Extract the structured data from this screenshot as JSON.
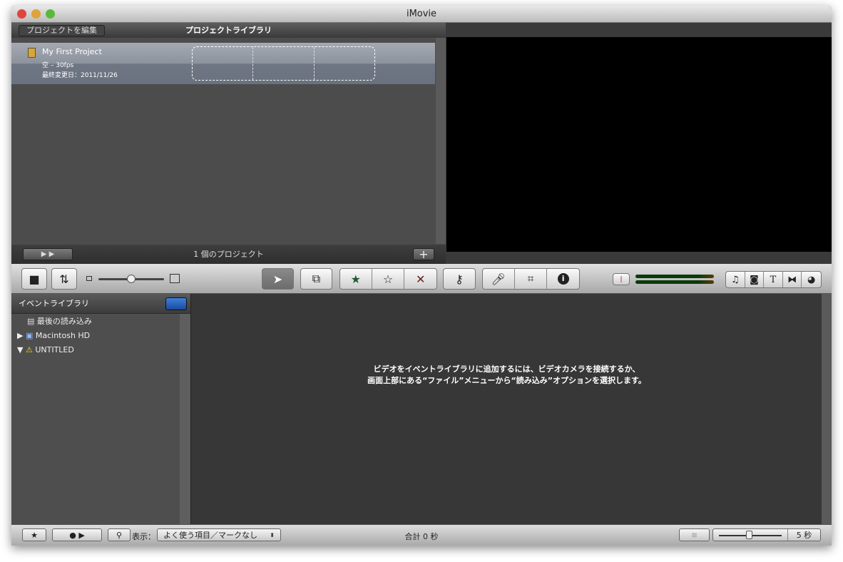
{
  "window": {
    "title": "iMovie"
  },
  "project_library": {
    "edit_button": "プロジェクトを編集",
    "title": "プロジェクトライブラリ",
    "project": {
      "name": "My First Project",
      "info": "空 – 30fps",
      "modified": "最終変更日：2011/11/26"
    },
    "count": "1 個のプロジェクト",
    "add": "+"
  },
  "event_library": {
    "title": "イベントライブラリ",
    "items": [
      {
        "label": "最後の読み込み"
      },
      {
        "label": "Macintosh HD"
      },
      {
        "label": "UNTITLED"
      }
    ]
  },
  "browser": {
    "message_line1": "ビデオをイベントライブラリに追加するには、ビデオカメラを接続するか、",
    "message_line2": "画面上部にある“ファイル”メニューから“読み込み”オプションを選択します。"
  },
  "bottom": {
    "show_label": "表示：",
    "filter_value": "よく使う項目／マークなし",
    "total": "合計 0 秒",
    "duration": "5 秒"
  },
  "icons": {
    "favorite": "★",
    "unmark": "☆",
    "reject": "✕",
    "info": "i",
    "music": "♫",
    "title": "T"
  },
  "colors": {
    "favorite": "#1f5a32",
    "reject": "#6b1e1e",
    "selected_row": "#8d939d"
  }
}
